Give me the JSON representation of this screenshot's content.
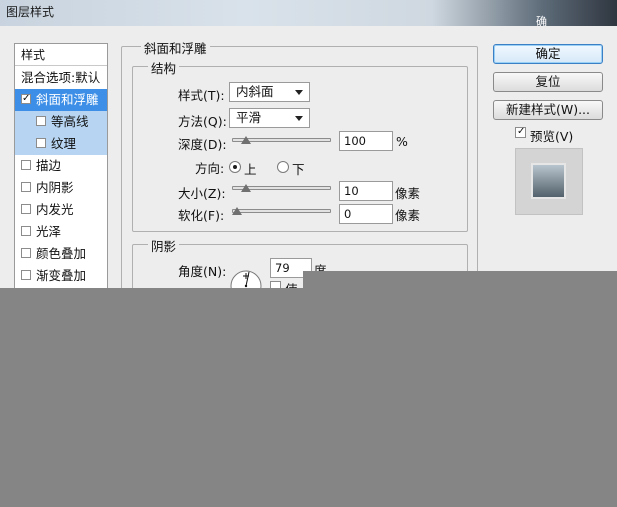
{
  "window": {
    "title": "图层样式",
    "title_right_text": "确"
  },
  "sidebar": {
    "header": "样式",
    "items": [
      {
        "label": "混合选项:默认",
        "checked": false
      },
      {
        "label": "斜面和浮雕",
        "checked": true,
        "selected": true
      },
      {
        "label": "等高线",
        "checked": false,
        "sub": true
      },
      {
        "label": "纹理",
        "checked": false,
        "sub": true
      },
      {
        "label": "描边",
        "checked": false
      },
      {
        "label": "内阴影",
        "checked": false
      },
      {
        "label": "内发光",
        "checked": false
      },
      {
        "label": "光泽",
        "checked": false
      },
      {
        "label": "颜色叠加",
        "checked": false
      },
      {
        "label": "渐变叠加",
        "checked": false
      }
    ],
    "check_glyph": "✓"
  },
  "bevel": {
    "section_title": "斜面和浮雕",
    "structure": {
      "title": "结构",
      "style_label": "样式(T):",
      "style_value": "内斜面",
      "technique_label": "方法(Q):",
      "technique_value": "平滑",
      "depth_label": "深度(D):",
      "depth_value": "100",
      "depth_unit": "%",
      "depth_fraction": 0.1,
      "direction_label": "方向:",
      "direction_up": "上",
      "direction_down": "下",
      "direction_selected": "up",
      "size_label": "大小(Z):",
      "size_value": "10",
      "size_unit": "像素",
      "size_fraction": 0.1,
      "soften_label": "软化(F):",
      "soften_value": "0",
      "soften_unit": "像素",
      "soften_fraction": 0
    },
    "shading": {
      "title": "阴影",
      "angle_label": "角度(N):",
      "angle_value": "79",
      "angle_unit": "度",
      "global_light_partial": "使"
    }
  },
  "buttons": {
    "ok": "确定",
    "reset": "复位",
    "new_style": "新建样式(W)...",
    "preview_label": "预览(V)",
    "preview_checked": true
  }
}
